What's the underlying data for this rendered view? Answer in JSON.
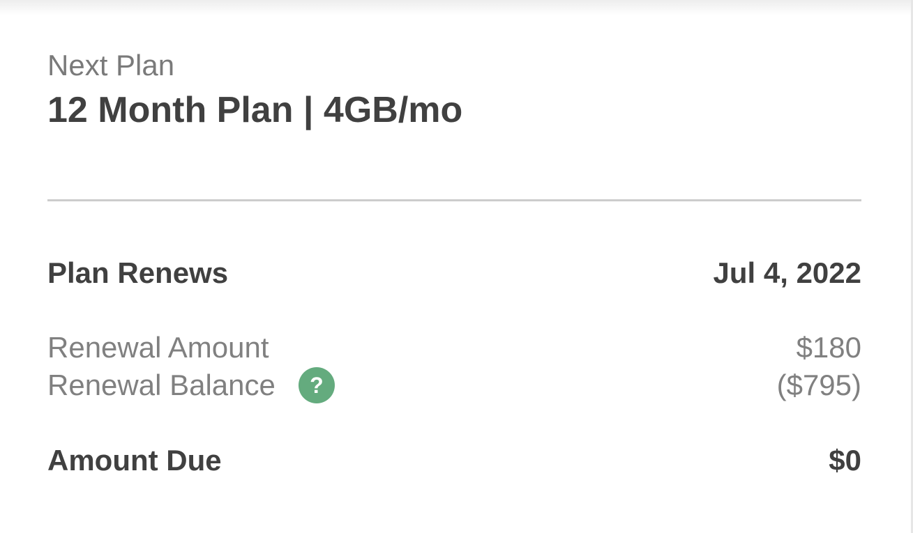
{
  "plan": {
    "subtitle": "Next Plan",
    "title": "12 Month Plan | 4GB/mo"
  },
  "summary": {
    "renews_label": "Plan Renews",
    "renews_date": "Jul 4, 2022",
    "renewal_amount_label": "Renewal Amount",
    "renewal_amount_value": "$180",
    "renewal_balance_label": "Renewal Balance",
    "renewal_balance_value": "($795)",
    "help_icon_glyph": "?",
    "amount_due_label": "Amount Due",
    "amount_due_value": "$0"
  },
  "colors": {
    "help_icon_bg": "#64ab7e",
    "text_dark": "#404040",
    "text_muted": "#808080",
    "divider": "#cccccc"
  },
  "icons": {
    "help": "question-mark-circle-icon"
  }
}
